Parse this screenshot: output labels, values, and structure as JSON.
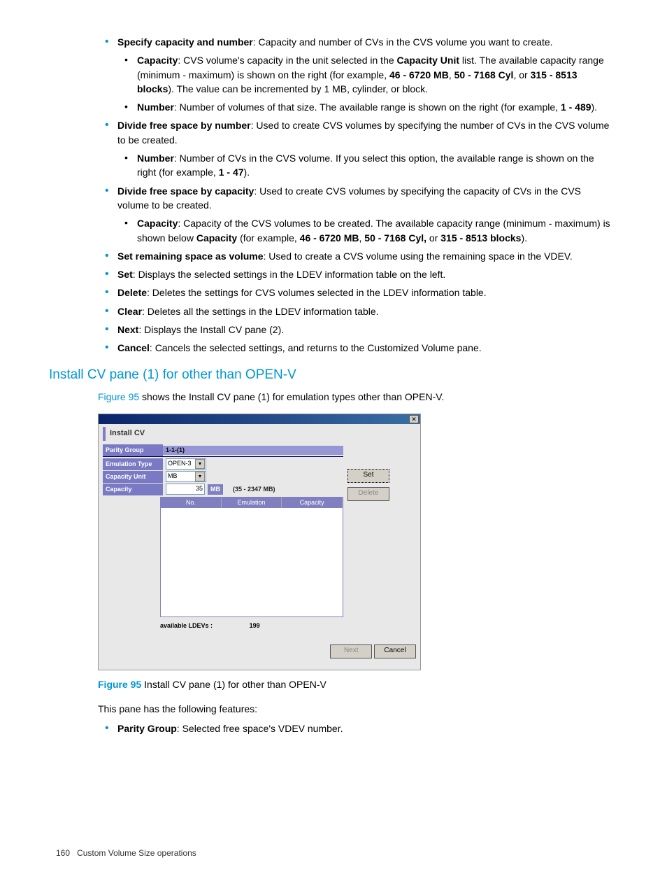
{
  "list": {
    "specify": {
      "head": "Specify capacity and number",
      "tail": ": Capacity and number of CVs in the CVS volume you want to create.",
      "cap_head": "Capacity",
      "cap_t1": ": CVS volume's capacity in the unit selected in the ",
      "cap_unit": "Capacity Unit",
      "cap_t2": " list. The available capacity range (minimum - maximum) is shown on the right (for example, ",
      "cap_r1": "46 - 6720 MB",
      "cap_r2": "50 - 7168 Cyl",
      "cap_or": ", or ",
      "cap_r3": "315 - 8513 blocks",
      "cap_t3": "). The value can be incremented by 1 MB, cylinder, or block.",
      "num_head": "Number",
      "num_t1": ": Number of volumes of that size. The available range is shown on the right (for example, ",
      "num_r": "1 -  489",
      "num_t2": ")."
    },
    "div_num": {
      "head": "Divide free space by number",
      "tail": ": Used to create CVS volumes by specifying the number of CVs in the CVS volume to be created.",
      "sub_head": "Number",
      "sub_t1": ": Number of CVs in the CVS volume. If you select this option, the available range is shown on the right (for example, ",
      "sub_r": "1 - 47",
      "sub_t2": ")."
    },
    "div_cap": {
      "head": "Divide free space by capacity",
      "tail": ": Used to create CVS volumes by specifying the capacity of CVs in the CVS volume to be created.",
      "sub_head": "Capacity",
      "sub_t1": ": Capacity of the CVS volumes to be created. The available capacity range (minimum - maximum) is shown below ",
      "sub_cap": "Capacity",
      "sub_t2": " (for example, ",
      "sub_r1": "46 - 6720 MB",
      "sub_r2": "50 - 7168 Cyl,",
      "sub_or": " or ",
      "sub_r3": "315 - 8513 blocks",
      "sub_t3": ")."
    },
    "set_rem": {
      "head": "Set remaining space as volume",
      "tail": ": Used to create a CVS volume using the remaining space in the VDEV."
    },
    "set": {
      "head": "Set",
      "tail": ": Displays the selected settings in the LDEV information table on the left."
    },
    "delete": {
      "head": "Delete",
      "tail": ": Deletes the settings for CVS volumes selected in the LDEV information table."
    },
    "clear": {
      "head": "Clear",
      "tail": ": Deletes all the settings in the LDEV information table."
    },
    "next": {
      "head": "Next",
      "tail": ": Displays the Install CV pane (2)."
    },
    "cancel": {
      "head": "Cancel",
      "tail": ": Cancels the selected settings, and returns to the Customized Volume pane."
    }
  },
  "section_title": "Install CV pane (1) for other than OPEN-V",
  "intro_link": "Figure 95",
  "intro_tail": " shows the Install CV pane (1) for emulation types other than OPEN-V.",
  "dialog": {
    "tab": "Install CV",
    "labels": {
      "pg": "Parity Group",
      "emu": "Emulation Type",
      "cu": "Capacity Unit",
      "cap": "Capacity"
    },
    "pg_val": "1-1-(1)",
    "emu_val": "OPEN-3",
    "cu_val": "MB",
    "cap_val": "35",
    "cap_unit": "MB",
    "cap_range": "(35 - 2347 MB)",
    "cols": {
      "no": "No.",
      "emu": "Emulation",
      "cap": "Capacity"
    },
    "avail_lbl": "available LDEVs :",
    "avail_val": "199",
    "btn": {
      "set": "Set",
      "del": "Delete",
      "next": "Next",
      "cancel": "Cancel"
    }
  },
  "fig_label": "Figure 95",
  "fig_caption": " Install CV pane (1) for other than OPEN-V",
  "after_fig": "This pane has the following features:",
  "after_item_head": "Parity Group",
  "after_item_tail": ": Selected free space's VDEV number.",
  "footer_page": "160",
  "footer_title": "Custom Volume Size operations"
}
